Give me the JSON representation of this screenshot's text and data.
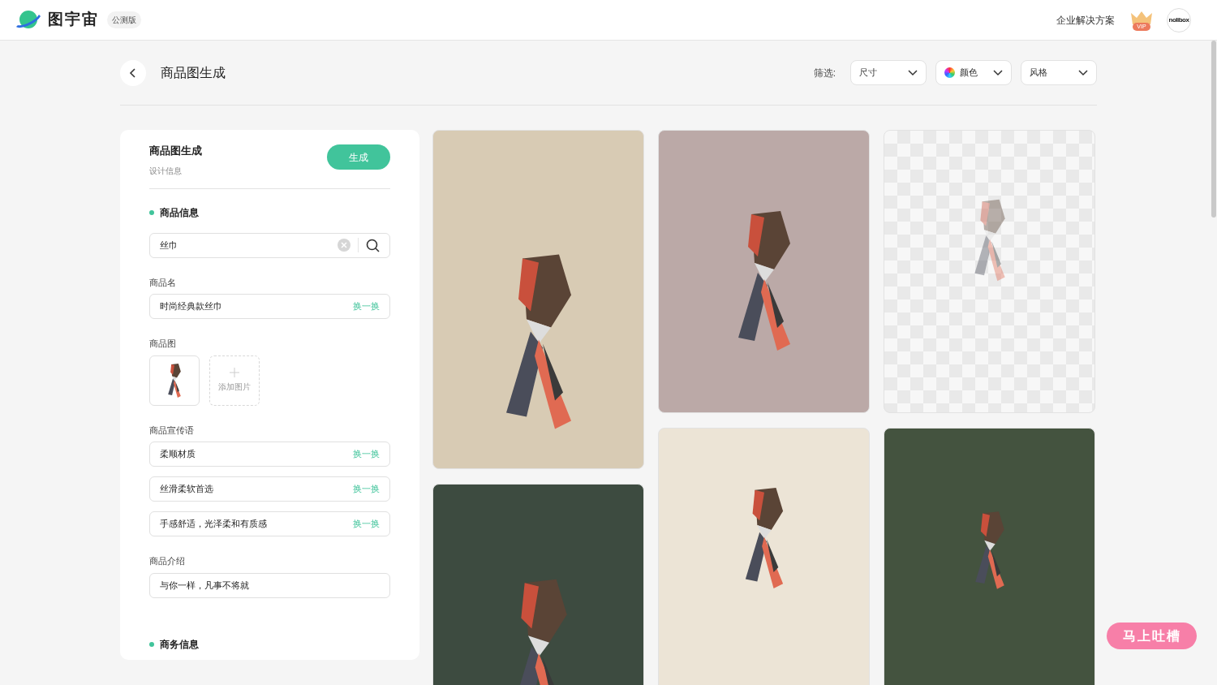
{
  "header": {
    "brand": "图宇宙",
    "badge": "公测版",
    "links": [
      "企业解决方案"
    ],
    "vip_label": "VIP",
    "avatar_label": "nolibox"
  },
  "page": {
    "title": "商品图生成",
    "filter_label": "筛选:",
    "filters": [
      {
        "label": "尺寸",
        "kind": "plain"
      },
      {
        "label": "颜色",
        "kind": "color"
      },
      {
        "label": "风格",
        "kind": "plain"
      }
    ]
  },
  "form": {
    "title": "商品图生成",
    "subtitle": "设计信息",
    "generate_button": "生成",
    "items": [
      {
        "kind": "section",
        "text": "商品信息"
      },
      {
        "kind": "search",
        "value": "丝巾"
      },
      {
        "kind": "label",
        "text": "商品名"
      },
      {
        "kind": "input",
        "value": "时尚经典款丝巾",
        "action": "换一换"
      },
      {
        "kind": "label",
        "text": "商品图"
      },
      {
        "kind": "images",
        "add_label": "添加图片"
      },
      {
        "kind": "label",
        "text": "商品宣传语"
      },
      {
        "kind": "input",
        "value": "柔顺材质",
        "action": "换一换"
      },
      {
        "kind": "input",
        "value": "丝滑柔软首选",
        "action": "换一换"
      },
      {
        "kind": "input",
        "value": "手感舒适，光泽柔和有质感",
        "action": "换一换"
      },
      {
        "kind": "label",
        "text": "商品介绍"
      },
      {
        "kind": "input",
        "value": "与你一样，凡事不将就"
      },
      {
        "kind": "section",
        "text": "商务信息"
      }
    ]
  },
  "posters": [
    [
      {
        "kind": "vertical"
      },
      {
        "kind": "arrival"
      }
    ],
    [
      {
        "kind": "framed"
      },
      {
        "kind": "bestseller"
      }
    ],
    [
      {
        "kind": "transparent"
      },
      {
        "kind": "showcase"
      }
    ]
  ],
  "feedback_button": "马上吐槽"
}
